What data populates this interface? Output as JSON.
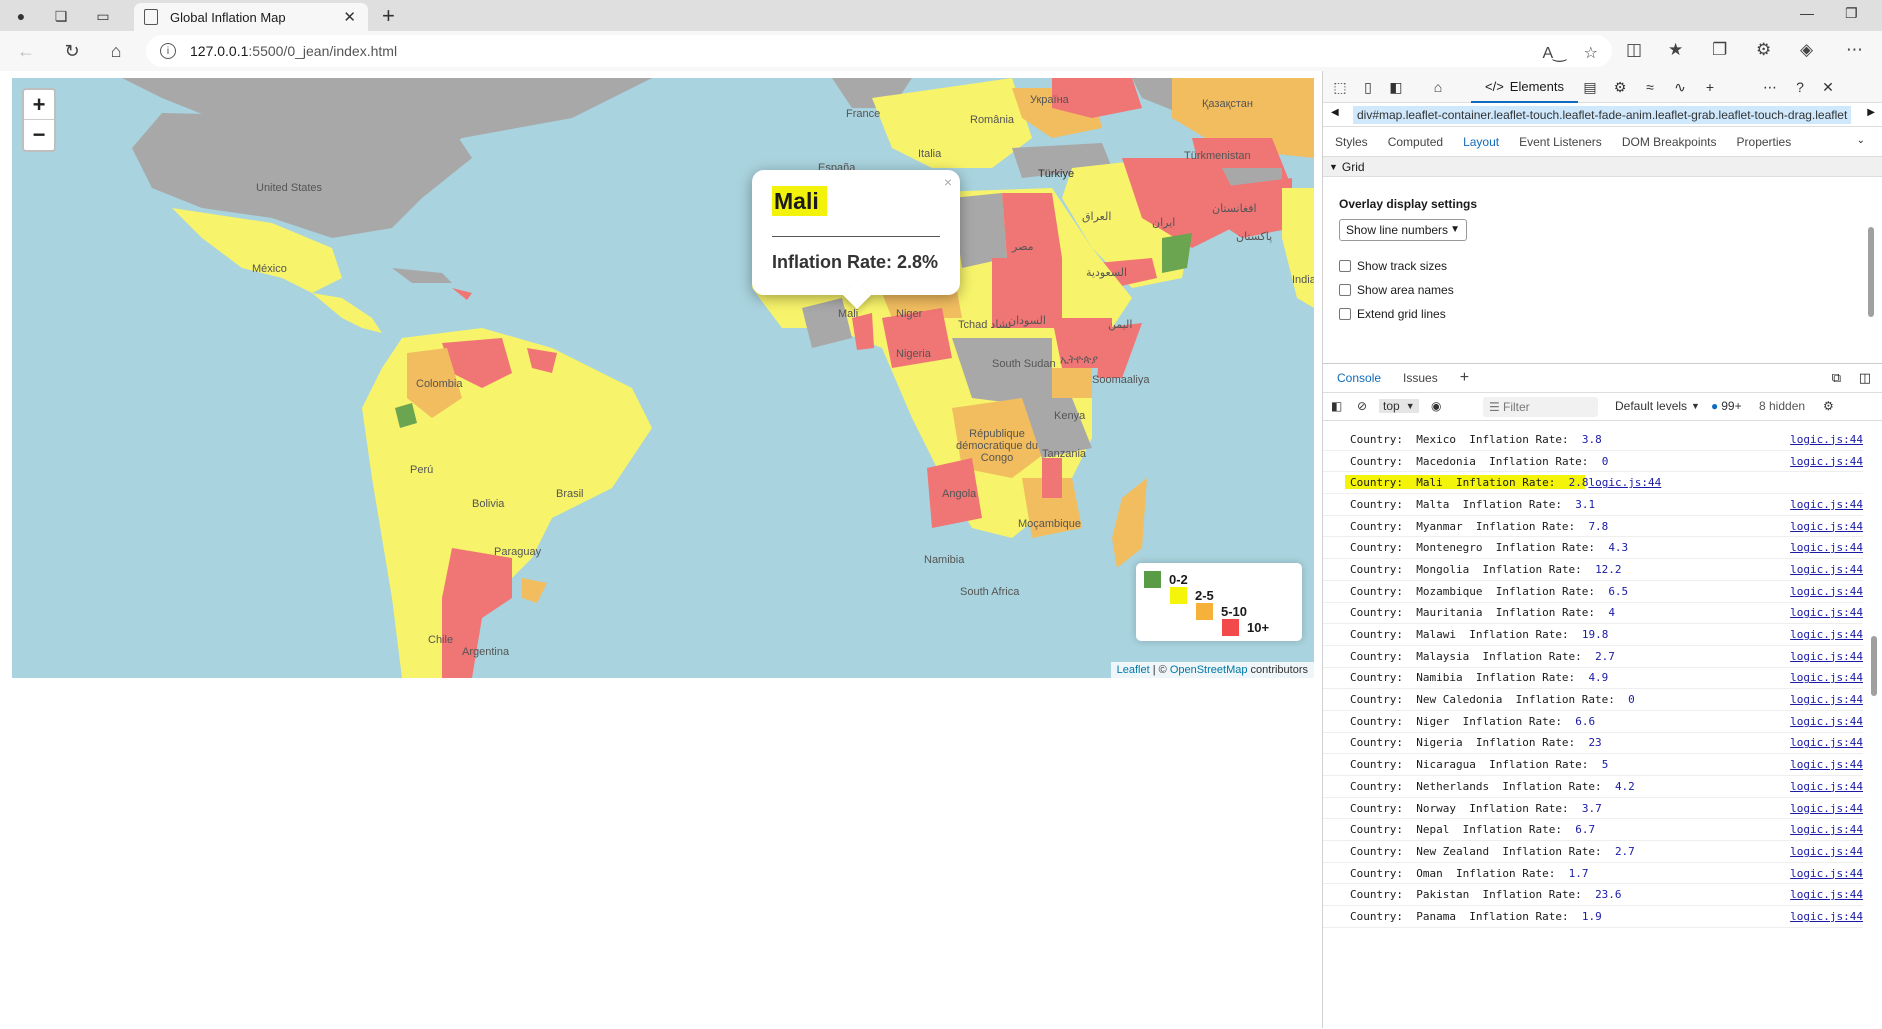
{
  "browser": {
    "tab_title": "Global Inflation Map",
    "url_host": "127.0.0.1",
    "url_path": ":5500/0_jean/index.html"
  },
  "map": {
    "zoom_in": "+",
    "zoom_out": "−",
    "labels": {
      "united_states": "United States",
      "mexico": "México",
      "colombia": "Colombia",
      "peru": "Perú",
      "brasil": "Brasil",
      "bolivia": "Bolivia",
      "paraguay": "Paraguay",
      "argentina": "Argentina",
      "chile": "Chile",
      "france": "France",
      "espana": "España",
      "italia": "Italia",
      "turkiye": "Türkiye",
      "romania": "România",
      "ukraine": "Україна",
      "kazakhstan": "Қазақстан",
      "mali": "Mali",
      "niger": "Niger",
      "tchad": "Tchad تشاد",
      "nigeria": "Nigeria",
      "egypt": "مصر",
      "sudan": "السودان",
      "south_sudan": "South Sudan",
      "ethiopia": "ኢትዮጵያ",
      "somalia": "Soomaaliya",
      "kenya": "Kenya",
      "tanzania": "Tanzania",
      "congo": "République démocratique du Congo",
      "angola": "Angola",
      "namibia": "Namibia",
      "mozambique": "Moçambique",
      "south_africa": "South Africa",
      "iraq": "العراق",
      "saudi": "السعودية",
      "yemen": "اليمن",
      "iran": "ایران",
      "pakistan": "پاکستان",
      "afghanistan": "افغانستان",
      "turkmenistan": "Türkmenistan",
      "india": "India"
    },
    "popup": {
      "close": "×",
      "title": "Mali",
      "rate_text": "Inflation Rate: 2.8%"
    },
    "legend": [
      {
        "label": "0-2",
        "color": "#5a9c46"
      },
      {
        "label": "2-5",
        "color": "#f5f50a"
      },
      {
        "label": "5-10",
        "color": "#f6b13a"
      },
      {
        "label": "10+",
        "color": "#f24a4a"
      }
    ],
    "attribution": {
      "leaflet": "Leaflet",
      "sep": " | © ",
      "osm": "OpenStreetMap",
      "suffix": " contributors"
    },
    "colors": {
      "ocean": "#a9d3de",
      "low": "#6ba54f",
      "mid": "#f7f36a",
      "high": "#f2bd5f",
      "very_high": "#f07575",
      "no_data": "#a8a8a8"
    }
  },
  "devtools": {
    "elements_tab": "Elements",
    "breadcrumb": "div#map.leaflet-container.leaflet-touch.leaflet-fade-anim.leaflet-grab.leaflet-touch-drag.leaflet",
    "subtabs": [
      "Styles",
      "Computed",
      "Layout",
      "Event Listeners",
      "DOM Breakpoints",
      "Properties"
    ],
    "grid_section": "Grid",
    "overlay_title": "Overlay display settings",
    "line_numbers_select": "Show line numbers",
    "checkboxes": [
      "Show track sizes",
      "Show area names",
      "Extend grid lines"
    ],
    "drawer_tabs": [
      "Console",
      "Issues"
    ],
    "console_context": "top",
    "filter_placeholder": "Filter",
    "default_levels": "Default levels",
    "issues_count": "99+",
    "hidden_count": "8 hidden",
    "logs": [
      {
        "country": "Mexico",
        "rate": "3.8"
      },
      {
        "country": "Macedonia",
        "rate": "0"
      },
      {
        "country": "Mali",
        "rate": "2.8"
      },
      {
        "country": "Malta",
        "rate": "3.1"
      },
      {
        "country": "Myanmar",
        "rate": "7.8"
      },
      {
        "country": "Montenegro",
        "rate": "4.3"
      },
      {
        "country": "Mongolia",
        "rate": "12.2"
      },
      {
        "country": "Mozambique",
        "rate": "6.5"
      },
      {
        "country": "Mauritania",
        "rate": "4"
      },
      {
        "country": "Malawi",
        "rate": "19.8"
      },
      {
        "country": "Malaysia",
        "rate": "2.7"
      },
      {
        "country": "Namibia",
        "rate": "4.9"
      },
      {
        "country": "New Caledonia",
        "rate": "0"
      },
      {
        "country": "Niger",
        "rate": "6.6"
      },
      {
        "country": "Nigeria",
        "rate": "23"
      },
      {
        "country": "Nicaragua",
        "rate": "5"
      },
      {
        "country": "Netherlands",
        "rate": "4.2"
      },
      {
        "country": "Norway",
        "rate": "3.7"
      },
      {
        "country": "Nepal",
        "rate": "6.7"
      },
      {
        "country": "New Zealand",
        "rate": "2.7"
      },
      {
        "country": "Oman",
        "rate": "1.7"
      },
      {
        "country": "Pakistan",
        "rate": "23.6"
      },
      {
        "country": "Panama",
        "rate": "1.9"
      }
    ],
    "log_country_key": "Country:",
    "log_rate_key": "Inflation Rate:",
    "log_source": "logic.js:44"
  }
}
